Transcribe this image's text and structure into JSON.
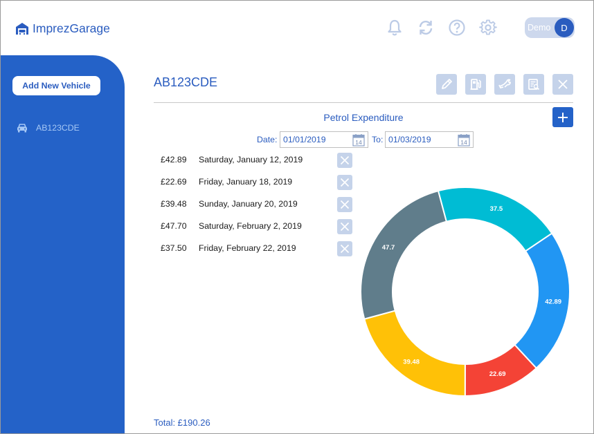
{
  "brand": {
    "name": "ImprezGarage",
    "icon": "garage-icon"
  },
  "header": {
    "icons": [
      "bell-icon",
      "refresh-icon",
      "help-icon",
      "gear-icon"
    ],
    "user": {
      "name": "Demo",
      "initial": "D"
    }
  },
  "sidebar": {
    "add_vehicle_label": "Add New Vehicle",
    "vehicles": [
      {
        "label": "AB123CDE",
        "icon": "car-icon"
      }
    ]
  },
  "vehicle": {
    "registration": "AB123CDE",
    "actions": [
      "edit-icon",
      "fuel-pump-icon",
      "wrench-icon",
      "report-icon",
      "close-icon"
    ]
  },
  "expenditure": {
    "title": "Petrol Expenditure",
    "date_from_label": "Date:",
    "date_from": "01/01/2019",
    "date_to_label": "To:",
    "date_to": "01/03/2019",
    "calendar_day": "14",
    "entries": [
      {
        "amount": "£42.89",
        "date": "Saturday, January 12, 2019"
      },
      {
        "amount": "£22.69",
        "date": "Friday, January 18, 2019"
      },
      {
        "amount": "£39.48",
        "date": "Sunday, January 20, 2019"
      },
      {
        "amount": "£47.70",
        "date": "Saturday, February 2, 2019"
      },
      {
        "amount": "£37.50",
        "date": "Friday, February 22, 2019"
      }
    ],
    "total": "Total: £190.26"
  },
  "colors": {
    "accent": "#2462c8",
    "brand_text": "#2a5cbf",
    "button_muted": "#c5d3ea"
  },
  "chart_data": {
    "type": "pie",
    "donut": true,
    "categories": [
      "",
      "",
      "",
      "",
      ""
    ],
    "values": [
      42.89,
      22.69,
      39.48,
      47.7,
      37.5
    ],
    "labels": [
      "42.89",
      "22.69",
      "39.48",
      "47.7",
      "37.5"
    ],
    "colors": [
      "#2196f3",
      "#f44336",
      "#ffc107",
      "#607d8b",
      "#00bcd4"
    ],
    "start_angle_deg": 56,
    "direction": "clockwise",
    "title": "",
    "legend": "none"
  }
}
